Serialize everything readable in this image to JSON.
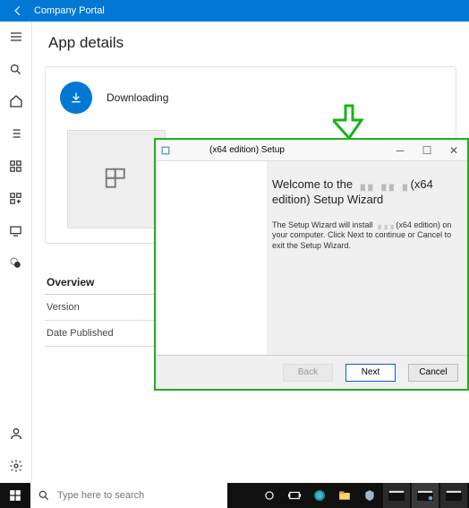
{
  "titlebar": {
    "title": "Company Portal"
  },
  "page": {
    "heading": "App details"
  },
  "download": {
    "status": "Downloading"
  },
  "meta": {
    "overview_label": "Overview",
    "rows": [
      "Version",
      "Date Published"
    ]
  },
  "installer": {
    "window_title": "(x64 edition) Setup",
    "heading_prefix": "Welcome to the ",
    "heading_suffix": "(x64 edition) Setup Wizard",
    "body_prefix": "The Setup Wizard will install ",
    "body_suffix": "(x64 edition) on your computer. Click Next to continue or Cancel to exit the Setup Wizard.",
    "buttons": {
      "back": "Back",
      "next": "Next",
      "cancel": "Cancel"
    }
  },
  "taskbar": {
    "search_placeholder": "Type here to search"
  }
}
